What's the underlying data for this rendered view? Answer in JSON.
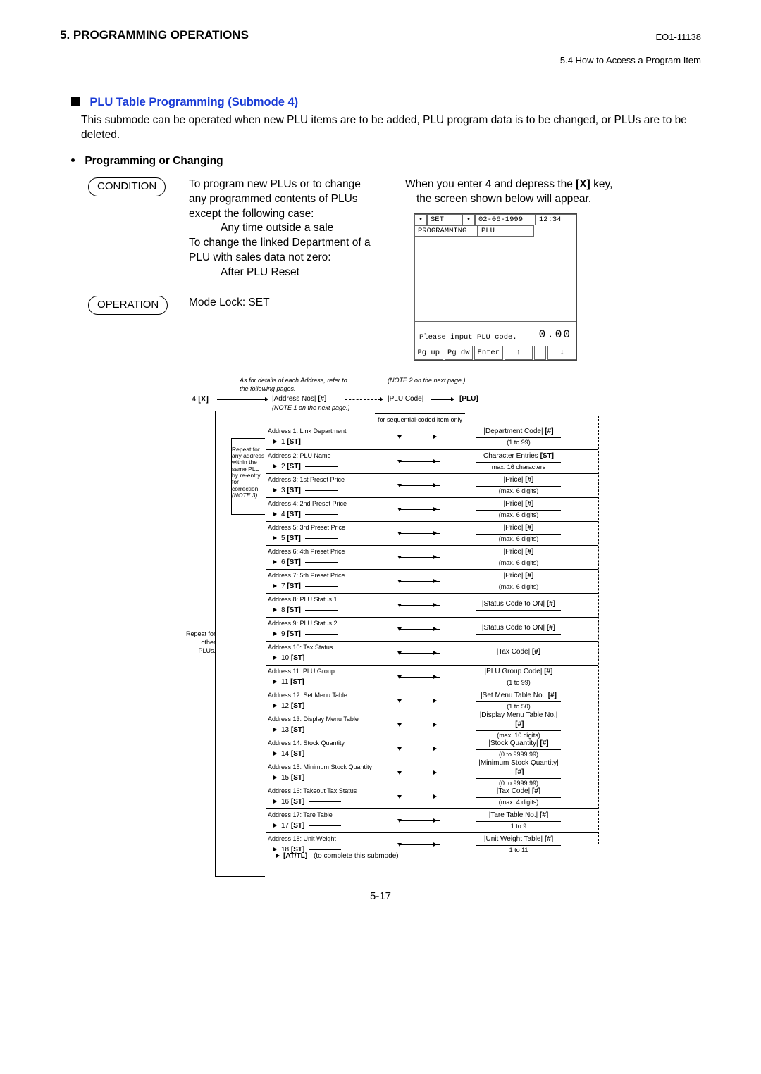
{
  "header": {
    "section_left": "5.   PROGRAMMING OPERATIONS",
    "code_right": "EO1-11138",
    "subsection_right": "5.4  How to Access a Program Item"
  },
  "section": {
    "title": "PLU Table Programming (Submode 4)",
    "intro": "This submode can be operated when new PLU items are to be added, PLU program data is to be changed, or PLUs are to be deleted.",
    "subhead": "Programming or Changing",
    "badge_condition": "CONDITION",
    "badge_operation": "OPERATION"
  },
  "condition": {
    "p1": "To program new PLUs or to change any programmed contents of PLUs except the following case:",
    "p1a": "Any time outside a sale",
    "p2": "To change the linked Department of a PLU with sales data not zero:",
    "p2a": "After PLU Reset"
  },
  "operation_text": "Mode Lock:  SET",
  "rightcol": {
    "line1": "When you enter 4 and depress the",
    "key": "[X]",
    "line1b": "key,",
    "line2": "the screen shown below will appear."
  },
  "screen": {
    "mode": "SET",
    "date": "02-06-1999",
    "time": "12:34",
    "tab1": "PROGRAMMING",
    "tab2": "PLU",
    "prompt": "Please input PLU code.",
    "value": "0.00",
    "sk1": "Pg up",
    "sk2": "Pg dw",
    "sk3": "Enter",
    "sk4": "↑",
    "sk5": "↓"
  },
  "flow": {
    "note_left": "As for details of each Address, refer to the following pages.",
    "note_right": "(NOTE 2 on the next page.)",
    "start": "4",
    "start_key": "[X]",
    "addr_nos": "|Address Nos|",
    "addr_key": "[#]",
    "plu_code": "|PLU Code|",
    "plu_key": "[PLU]",
    "note1": "(NOTE 1 on the next page.)",
    "seq_note": "for sequential-coded item only",
    "repeat_inner": "Repeat for any address within the same PLU by re-entry for correction.",
    "repeat_inner_note": "(NOTE 3)",
    "repeat_outer1": "Repeat for",
    "repeat_outer2": "other",
    "repeat_outer3": "PLUs.",
    "at_tl": "[AT/TL]",
    "at_tl_note": "(to complete this submode)",
    "rows": [
      {
        "t": "Address 1:  Link Department",
        "n": "1",
        "k": "[ST]",
        "r": "|Department Code|",
        "rk": "[#]",
        "s": "(1 to 99)"
      },
      {
        "t": "Address 2:  PLU Name",
        "n": "2",
        "k": "[ST]",
        "r": "Character Entries",
        "rk": "[ST]",
        "s": "max. 16 characters"
      },
      {
        "t": "Address 3:  1st Preset Price",
        "n": "3",
        "k": "[ST]",
        "r": "|Price|",
        "rk": "[#]",
        "s": "(max. 6 digits)"
      },
      {
        "t": "Address 4:  2nd Preset Price",
        "n": "4",
        "k": "[ST]",
        "r": "|Price|",
        "rk": "[#]",
        "s": "(max. 6 digits)"
      },
      {
        "t": "Address 5:  3rd Preset Price",
        "n": "5",
        "k": "[ST]",
        "r": "|Price|",
        "rk": "[#]",
        "s": "(max. 6 digits)"
      },
      {
        "t": "Address 6:  4th Preset Price",
        "n": "6",
        "k": "[ST]",
        "r": "|Price|",
        "rk": "[#]",
        "s": "(max. 6 digits)"
      },
      {
        "t": "Address 7:  5th Preset Price",
        "n": "7",
        "k": "[ST]",
        "r": "|Price|",
        "rk": "[#]",
        "s": "(max. 6 digits)"
      },
      {
        "t": "Address 8:  PLU Status 1",
        "n": "8",
        "k": "[ST]",
        "r": "|Status Code to ON|",
        "rk": "[#]",
        "s": ""
      },
      {
        "t": "Address 9:  PLU Status 2",
        "n": "9",
        "k": "[ST]",
        "r": "|Status Code to ON|",
        "rk": "[#]",
        "s": ""
      },
      {
        "t": "Address 10:  Tax Status",
        "n": "10",
        "k": "[ST]",
        "r": "|Tax Code|",
        "rk": "[#]",
        "s": ""
      },
      {
        "t": "Address 11:  PLU Group",
        "n": "11",
        "k": "[ST]",
        "r": "|PLU Group Code|",
        "rk": "[#]",
        "s": "(1 to 99)"
      },
      {
        "t": "Address 12:  Set Menu Table",
        "n": "12",
        "k": "[ST]",
        "r": "|Set Menu Table No.|",
        "rk": "[#]",
        "s": "(1 to 50)"
      },
      {
        "t": "Address 13:  Display Menu Table",
        "n": "13",
        "k": "[ST]",
        "r": "|Display Menu Table No.|",
        "rk": "[#]",
        "s": "(max. 10 digits)"
      },
      {
        "t": "Address 14:  Stock Quantity",
        "n": "14",
        "k": "[ST]",
        "r": "|Stock Quantity|",
        "rk": "[#]",
        "s": "(0 to 9999.99)"
      },
      {
        "t": "Address 15:  Minimum Stock Quantity",
        "n": "15",
        "k": "[ST]",
        "r": "|Minimum Stock Quantity|",
        "rk": "[#]",
        "s": "(0 to 9999.99)"
      },
      {
        "t": "Address 16:  Takeout Tax Status",
        "n": "16",
        "k": "[ST]",
        "r": "|Tax Code|",
        "rk": "[#]",
        "s": "(max. 4 digits)"
      },
      {
        "t": "Address 17:  Tare Table",
        "n": "17",
        "k": "[ST]",
        "r": "|Tare Table No.|",
        "rk": "[#]",
        "s": "1 to 9"
      },
      {
        "t": "Address 18:  Unit Weight",
        "n": "18",
        "k": "[ST]",
        "r": "|Unit Weight Table|",
        "rk": "[#]",
        "s": "1 to 11"
      }
    ]
  },
  "page_number": "5-17"
}
